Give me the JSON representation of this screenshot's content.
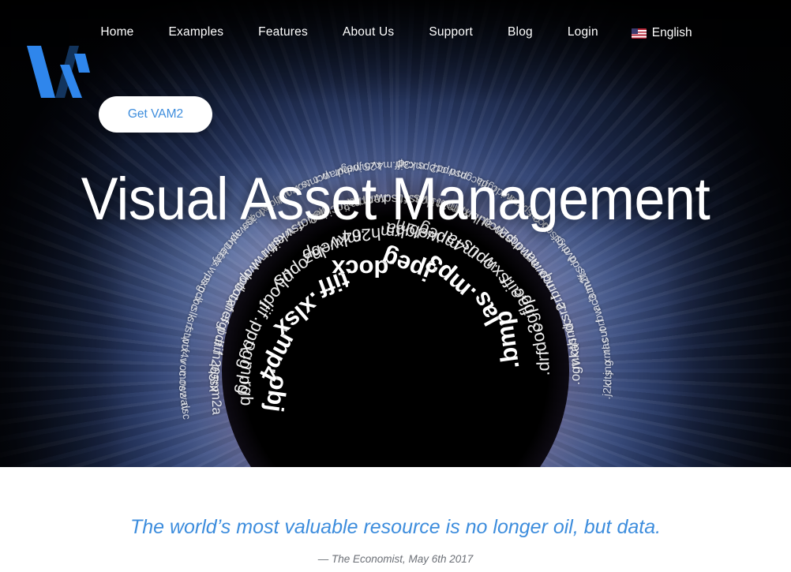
{
  "brand": {
    "logo_name": "vam-logo",
    "accent_color": "#3d8ddd",
    "logo_color": "#2f86ec"
  },
  "nav": {
    "items": [
      {
        "label": "Home"
      },
      {
        "label": "Examples"
      },
      {
        "label": "Features"
      },
      {
        "label": "About Us"
      },
      {
        "label": "Support"
      },
      {
        "label": "Blog"
      },
      {
        "label": "Login"
      }
    ],
    "language": {
      "label": "English",
      "flag": "us-flag-icon"
    }
  },
  "hero": {
    "cta_label": "Get VAM2",
    "headline": "Visual Asset Management",
    "background": "eye-iris-photo"
  },
  "quote_section": {
    "quote": "The world’s most valuable resource is no longer oil, but data.",
    "attribution": "— The Economist, May 6th 2017"
  },
  "word_cloud": {
    "description": "file extensions arranged in concentric arcs radiating from the pupil",
    "rings": [
      {
        "radius": 148,
        "font_size": 31,
        "weight": "700",
        "opacity": 1,
        "start_angle": 188,
        "end_angle": 352,
        "items": [
          ".obj",
          ".mp4",
          ".xlsx",
          ".tiff",
          ".docx",
          ".jpeg",
          ".mp3",
          ".las",
          ".bmp"
        ]
      },
      {
        "radius": 188,
        "font_size": 22,
        "weight": "400",
        "opacity": 0.92,
        "start_angle": 182,
        "end_angle": 358,
        "items": [
          ".rgb",
          ".mpg",
          ".ogg",
          ".pptx",
          ".jif",
          ".odt",
          ".ply",
          ".opus",
          ".laz",
          ".webp",
          ".mkv",
          ".h264",
          ".rm",
          ".rgba",
          ".webm",
          ".mpeg",
          ".m4a",
          ".opus",
          ".sxw",
          ".aiff",
          ".flac",
          ".3gpp",
          ".doc",
          ".drf"
        ]
      },
      {
        "radius": 228,
        "font_size": 17,
        "weight": "400",
        "opacity": 0.85,
        "start_angle": 178,
        "end_angle": 362,
        "items": [
          ".m2a",
          ".rm",
          ".ppsx",
          ".h265",
          ".aif",
          ".pdf",
          ".sgi",
          ".nef",
          ".caf",
          ".dotx",
          ".vob",
          ".wdp",
          ".rwl",
          ".bit",
          ".aiff",
          ".wks",
          ".csv",
          ".uof",
          ".jp2",
          ".cine",
          ".liq",
          ".m3u",
          ".oma",
          ".ram",
          ".sdw",
          ".sti",
          ".asf",
          ".dds",
          ".m1v",
          ".m2t",
          ".xbm",
          ".lbm",
          ".au",
          ".pcd",
          ".srw",
          ".mp2",
          ".mdc",
          ".arw",
          ".wma",
          ".rco",
          ".bmq",
          ".erf",
          ".sr2",
          ".dc",
          ".snd",
          ".oth",
          ".mka",
          ".ogv"
        ]
      },
      {
        "radius": 268,
        "font_size": 14,
        "weight": "400",
        "opacity": 0.74,
        "start_angle": 174,
        "end_angle": 366,
        "items": [
          ".dsc",
          ".wav",
          ".rwz",
          ".mos",
          ".voc",
          ".f4v",
          ".ptx",
          ".stw",
          ".srf",
          ".slk",
          ".lbc",
          ".pcx",
          ".sxg",
          ".wps",
          ".ts",
          ".bay",
          ".mef",
          ".wk1",
          ".wap",
          ".jpe",
          ".loas",
          ".pxl",
          ".hdp",
          ".ualj",
          ".ico",
          ".vox",
          ".mts",
          ".pct",
          ".raw",
          ".hdr",
          ".wmv",
          ".mjpeg",
          ".k25",
          ".m4v",
          ".iff",
          ".cap",
          ".mk3d",
          ".pps",
          ".cr2",
          ".wpd",
          ".psd",
          ".cgm",
          ".jtt",
          ".rgba",
          ".rdc",
          ".avi",
          ".amr",
          ".spx",
          ".raf",
          ".dc2",
          ".sdp",
          ".gif",
          ".mks",
          ".dvd",
          ".sdd",
          ".fff",
          ".m2ts",
          ".latm",
          ".ac3",
          ".bw",
          ".orf",
          ".cut",
          ".ras",
          ".xml",
          ".jng",
          ".dts",
          ".j2k"
        ]
      }
    ]
  }
}
